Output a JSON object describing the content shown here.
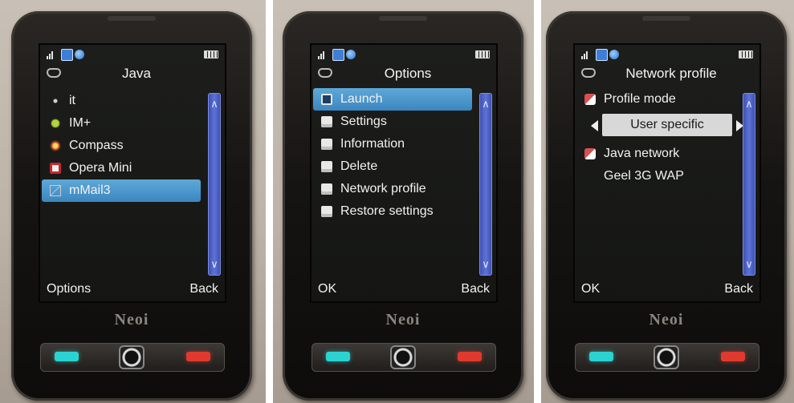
{
  "screens": [
    {
      "title": "Java",
      "items": [
        {
          "label": "it",
          "icon": "dot-icon",
          "selected": false
        },
        {
          "label": "IM+",
          "icon": "eye-icon",
          "selected": false
        },
        {
          "label": "Compass",
          "icon": "compass-icon",
          "selected": false
        },
        {
          "label": "Opera Mini",
          "icon": "opera-icon",
          "selected": false
        },
        {
          "label": "mMail3",
          "icon": "mail-icon",
          "selected": true
        }
      ],
      "softkey_left": "Options",
      "softkey_right": "Back"
    },
    {
      "title": "Options",
      "items": [
        {
          "label": "Launch",
          "icon": "launch-icon",
          "selected": true
        },
        {
          "label": "Settings",
          "icon": "menu-icon",
          "selected": false
        },
        {
          "label": "Information",
          "icon": "menu-icon",
          "selected": false
        },
        {
          "label": "Delete",
          "icon": "menu-icon",
          "selected": false
        },
        {
          "label": "Network profile",
          "icon": "menu-icon",
          "selected": false
        },
        {
          "label": "Restore settings",
          "icon": "menu-icon",
          "selected": false
        }
      ],
      "softkey_left": "OK",
      "softkey_right": "Back"
    },
    {
      "title": "Network profile",
      "profile_mode_label": "Profile mode",
      "profile_mode_value": "User specific",
      "java_network_label": "Java network",
      "java_network_value": "Geel 3G WAP",
      "softkey_left": "OK",
      "softkey_right": "Back"
    }
  ],
  "scroll_up": "∧",
  "scroll_down": "∨",
  "brand_logo": "Neoi",
  "colors": {
    "selection": "#4f9fd3",
    "scrollbar": "#4a5ec8",
    "call_key": "#2ad3d2",
    "end_key": "#e03a2e"
  }
}
